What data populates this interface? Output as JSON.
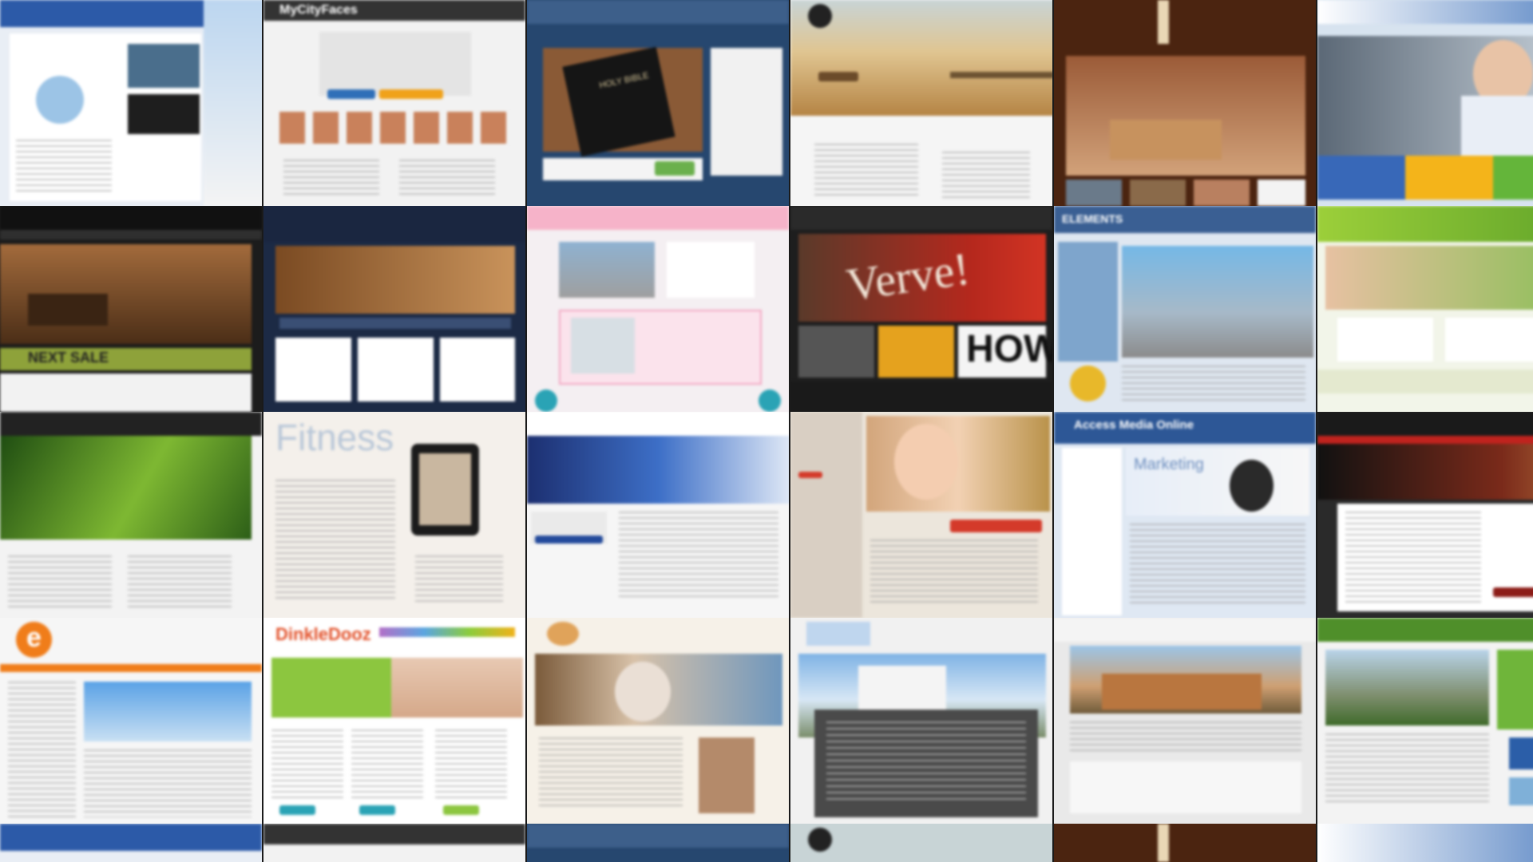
{
  "wall": {
    "rows": [
      {
        "tiles": [
          {
            "name": "site-counseling",
            "text": ""
          },
          {
            "name": "site-mycityfaces",
            "text": "MyCityFaces"
          },
          {
            "name": "site-bible",
            "text": "HOLY BIBLE"
          },
          {
            "name": "site-bridge",
            "text": ""
          },
          {
            "name": "site-resort",
            "text": ""
          },
          {
            "name": "site-business-woman",
            "text": ""
          }
        ]
      },
      {
        "tiles": [
          {
            "name": "site-estate-sales",
            "text": "NEXT SALE"
          },
          {
            "name": "site-law-gavel",
            "text": ""
          },
          {
            "name": "site-fitness-pink",
            "text": ""
          },
          {
            "name": "site-verve",
            "text": "Verve!",
            "text2": "HOW"
          },
          {
            "name": "site-elements",
            "text": "ELEMENTS"
          },
          {
            "name": "site-kids",
            "text": ""
          }
        ]
      },
      {
        "tiles": [
          {
            "name": "site-growing",
            "text": ""
          },
          {
            "name": "site-fitness",
            "text": "Fitness"
          },
          {
            "name": "site-the-group",
            "text": ""
          },
          {
            "name": "site-child",
            "text": ""
          },
          {
            "name": "site-access-media",
            "text": "Access Media Online",
            "text2": "Marketing"
          },
          {
            "name": "site-law-firm",
            "text": ""
          }
        ]
      },
      {
        "tiles": [
          {
            "name": "site-orange-e",
            "text": "e"
          },
          {
            "name": "site-dinkledooz",
            "text": "DinkleDooz"
          },
          {
            "name": "site-medical",
            "text": ""
          },
          {
            "name": "site-capital",
            "text": ""
          },
          {
            "name": "site-building",
            "text": ""
          },
          {
            "name": "site-green-town",
            "text": ""
          }
        ]
      }
    ]
  },
  "colors": {
    "navy": "#1f3a6e",
    "dark": "#1c1c1c",
    "orange": "#f07d1a",
    "green": "#7fb51e",
    "pink": "#f6b3c9",
    "brown": "#5b3216",
    "sand": "#c9a06a",
    "red": "#c0231e",
    "blue": "#3a78c2"
  }
}
